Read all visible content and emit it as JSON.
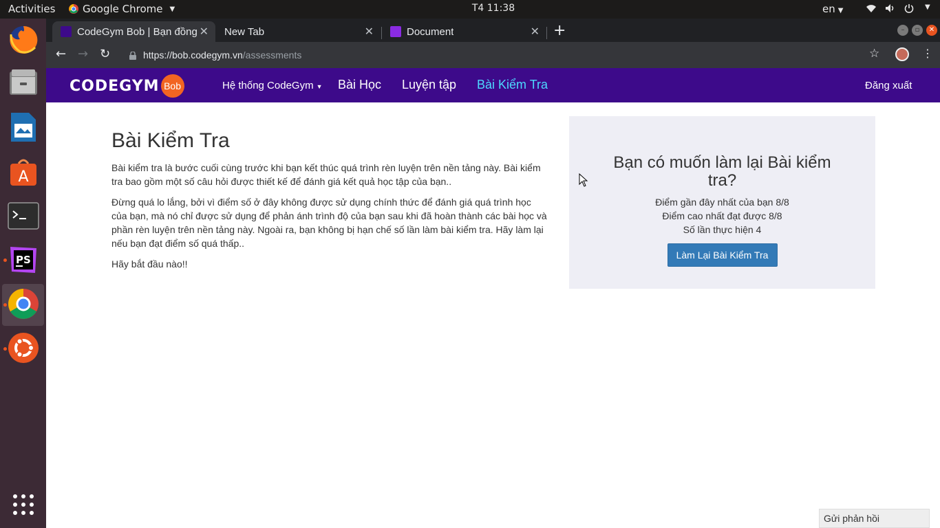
{
  "topbar": {
    "activities": "Activities",
    "app_name": "Google Chrome",
    "clock": "T4 11:38",
    "lang": "en"
  },
  "dock": {
    "items": [
      {
        "name": "firefox-icon"
      },
      {
        "name": "file-manager-icon"
      },
      {
        "name": "writer-icon"
      },
      {
        "name": "software-center-icon"
      },
      {
        "name": "terminal-icon"
      },
      {
        "name": "phpstorm-icon"
      },
      {
        "name": "chrome-icon"
      },
      {
        "name": "ubuntu-icon"
      },
      {
        "name": "app-grid-icon"
      }
    ]
  },
  "browser": {
    "tabs": [
      {
        "title": "CodeGym Bob | Bạn đồng"
      },
      {
        "title": "New Tab"
      },
      {
        "title": "Document"
      }
    ],
    "url_host": "https://bob.codegym.vn",
    "url_path": "/assessments"
  },
  "sitenav": {
    "logo_word": "CODEGYM",
    "logo_badge": "Bob",
    "system_menu": "Hệ thống CodeGym",
    "lessons": "Bài Học",
    "practice": "Luyện tập",
    "assessments": "Bài Kiểm Tra",
    "logout": "Đăng xuất"
  },
  "main": {
    "title": "Bài Kiểm Tra",
    "para1": "Bài kiểm tra là bước cuối cùng trước khi bạn kết thúc quá trình rèn luyện trên nền tảng này. Bài kiểm tra bao gồm một số câu hỏi được thiết kế để đánh giá kết quả học tập của bạn..",
    "para2": "Đừng quá lo lắng, bởi vì điểm số ở đây không được sử dụng chính thức để đánh giá quá trình học của bạn, mà nó chỉ được sử dụng để phản ánh trình độ của bạn sau khi đã hoàn thành các bài học và phần rèn luyện trên nền tảng này. Ngoài ra, bạn không bị hạn chế số lần làm bài kiểm tra. Hãy làm lại nếu bạn đạt điểm số quá thấp..",
    "para3": "Hãy bắt đầu nào!!"
  },
  "panel": {
    "heading": "Bạn có muốn làm lại Bài kiểm tra?",
    "recent_score": "Điểm gần đây nhất của bạn 8/8",
    "best_score": "Điểm cao nhất đạt được 8/8",
    "attempts": "Số lần thực hiện 4",
    "retake_button": "Làm Lại Bài Kiểm Tra"
  },
  "feedback": "Gửi phản hồi",
  "colors": {
    "nav_bg": "#3d0a8a",
    "nav_active": "#4dd9ff",
    "panel_bg": "#eeeef5",
    "button_bg": "#337ab7",
    "logo_badge": "#f26522"
  }
}
